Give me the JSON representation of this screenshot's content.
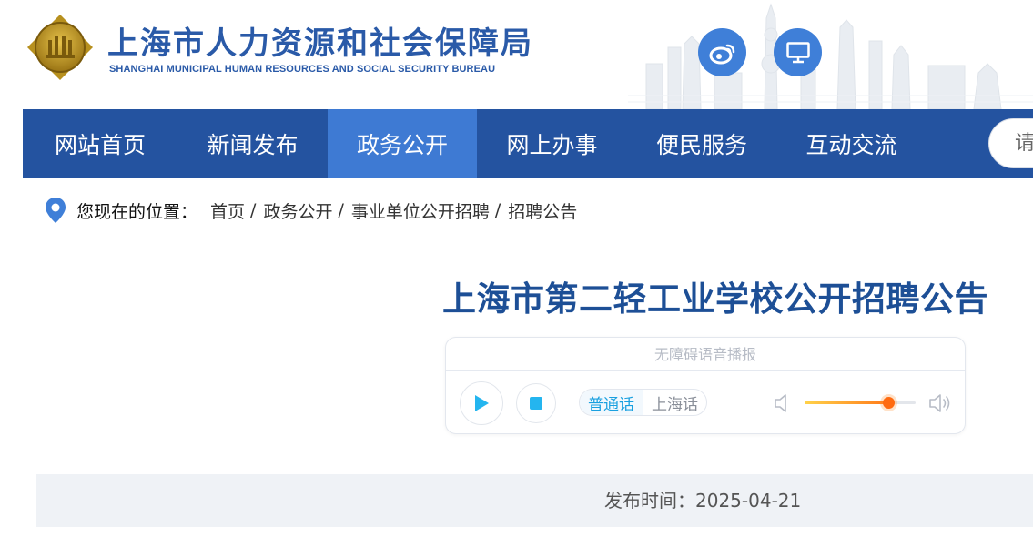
{
  "header": {
    "title": "上海市人力资源和社会保障局",
    "subtitle": "SHANGHAI MUNICIPAL HUMAN RESOURCES AND SOCIAL SECURITY BUREAU",
    "logo_icon": "bureau-emblem-icon",
    "social_buttons": [
      {
        "name": "weibo",
        "icon": "weibo-icon",
        "color": "#3f7fd8"
      },
      {
        "name": "desktop",
        "icon": "monitor-icon",
        "color": "#3f7fd8"
      }
    ]
  },
  "nav": {
    "items": [
      {
        "label": "网站首页",
        "active": false
      },
      {
        "label": "新闻发布",
        "active": false
      },
      {
        "label": "政务公开",
        "active": true
      },
      {
        "label": "网上办事",
        "active": false
      },
      {
        "label": "便民服务",
        "active": false
      },
      {
        "label": "互动交流",
        "active": false
      }
    ],
    "search_placeholder": "请",
    "bg_color": "#2453a0",
    "active_color": "#3e7ad3"
  },
  "breadcrumb": {
    "icon": "location-pin-icon",
    "label": "您现在的位置：",
    "items": [
      "首页",
      "政务公开",
      "事业单位公开招聘",
      "招聘公告"
    ],
    "separator": "/"
  },
  "article": {
    "title": "上海市第二轻工业学校公开招聘公告",
    "publish_label": "发布时间：",
    "publish_date": "2025-04-21"
  },
  "audio_player": {
    "title": "无障碍语音播报",
    "dialects": [
      "普通话",
      "上海话"
    ],
    "selected_dialect": "普通话",
    "volume": 0.75,
    "accent_color": "#19a0e0"
  }
}
